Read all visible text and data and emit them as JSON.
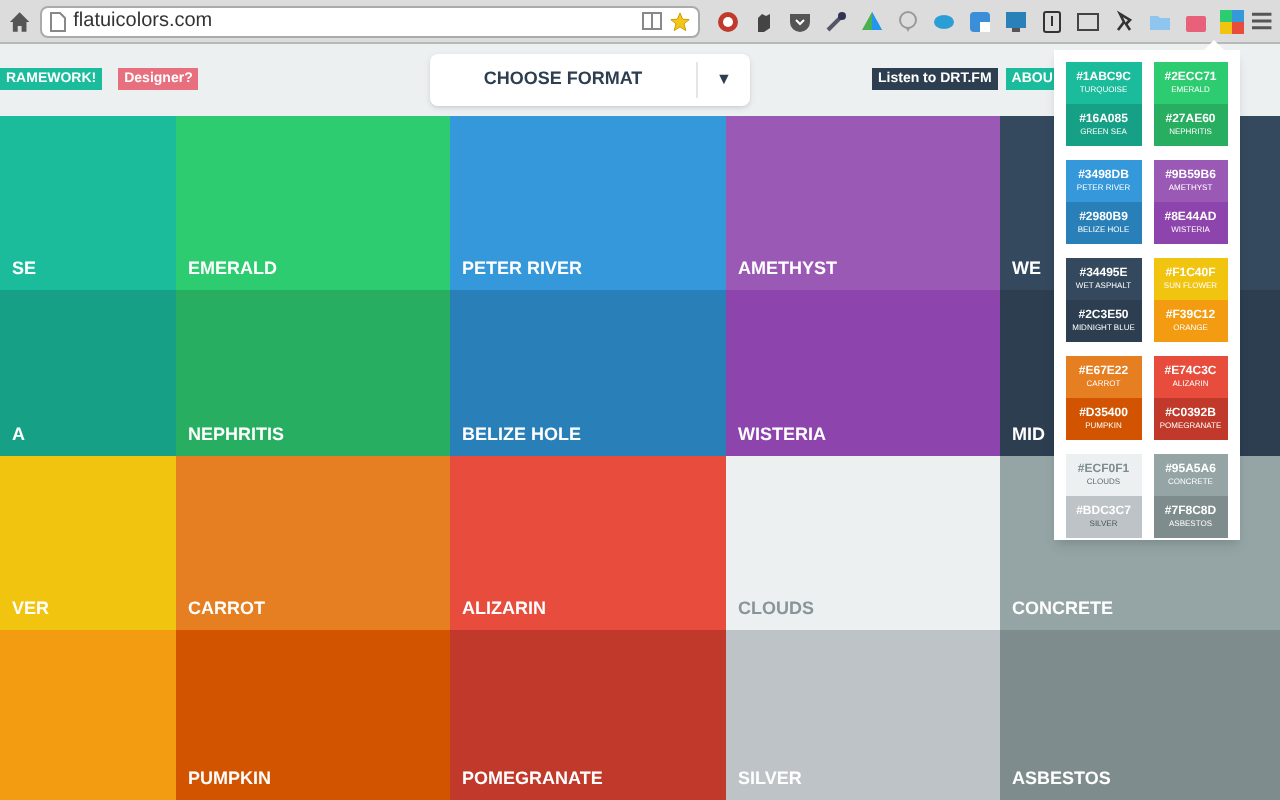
{
  "browser": {
    "url": "flatuicolors.com"
  },
  "header": {
    "badges": [
      {
        "text": "RAMEWORK!",
        "color": "#1abc9c"
      },
      {
        "text": "Designer?",
        "color": "#e8707e"
      }
    ],
    "format_select": {
      "label": "CHOOSE FORMAT",
      "arrow": "▼"
    },
    "right_badges": [
      {
        "text": "Listen to DRT.FM",
        "color": "#2c3e50"
      },
      {
        "text": "ABOU",
        "color": "#1abc9c"
      }
    ]
  },
  "tiles": [
    [
      {
        "label": "SE",
        "color": "#1abc9c"
      },
      {
        "label": "EMERALD",
        "color": "#2ecc71"
      },
      {
        "label": "PETER RIVER",
        "color": "#3498db"
      },
      {
        "label": "AMETHYST",
        "color": "#9b59b6"
      },
      {
        "label": "WE",
        "color": "#34495e"
      }
    ],
    [
      {
        "label": "A",
        "color": "#16a085"
      },
      {
        "label": "NEPHRITIS",
        "color": "#27ae60"
      },
      {
        "label": "BELIZE HOLE",
        "color": "#2980b9"
      },
      {
        "label": "WISTERIA",
        "color": "#8e44ad"
      },
      {
        "label": "MID",
        "color": "#2c3e50"
      }
    ],
    [
      {
        "label": "VER",
        "color": "#f1c40f"
      },
      {
        "label": "CARROT",
        "color": "#e67e22"
      },
      {
        "label": "ALIZARIN",
        "color": "#e74c3c"
      },
      {
        "label": "CLOUDS",
        "color": "#ecf0f1"
      },
      {
        "label": "CONCRETE",
        "color": "#95a5a6"
      }
    ],
    [
      {
        "color": "#f39c12"
      },
      {
        "label": "PUMPKIN",
        "color": "#d35400"
      },
      {
        "label": "POMEGRANATE",
        "color": "#c0392b"
      },
      {
        "label": "SILVER",
        "color": "#bdc3c7"
      },
      {
        "label": "ASBESTOS",
        "color": "#7f8c8d"
      }
    ]
  ],
  "popup": [
    [
      {
        "hex": "#1ABC9C",
        "name": "TURQUOISE",
        "color": "#1abc9c"
      },
      {
        "hex": "#16A085",
        "name": "GREEN SEA",
        "color": "#16a085"
      }
    ],
    [
      {
        "hex": "#2ECC71",
        "name": "EMERALD",
        "color": "#2ecc71"
      },
      {
        "hex": "#27AE60",
        "name": "NEPHRITIS",
        "color": "#27ae60"
      }
    ],
    [
      {
        "hex": "#3498DB",
        "name": "PETER RIVER",
        "color": "#3498db"
      },
      {
        "hex": "#2980B9",
        "name": "BELIZE HOLE",
        "color": "#2980b9"
      }
    ],
    [
      {
        "hex": "#9B59B6",
        "name": "AMETHYST",
        "color": "#9b59b6"
      },
      {
        "hex": "#8E44AD",
        "name": "WISTERIA",
        "color": "#8e44ad"
      }
    ],
    [
      {
        "hex": "#34495E",
        "name": "WET ASPHALT",
        "color": "#34495e"
      },
      {
        "hex": "#2C3E50",
        "name": "MIDNIGHT BLUE",
        "color": "#2c3e50"
      }
    ],
    [
      {
        "hex": "#F1C40F",
        "name": "SUN FLOWER",
        "color": "#f1c40f"
      },
      {
        "hex": "#F39C12",
        "name": "ORANGE",
        "color": "#f39c12"
      }
    ],
    [
      {
        "hex": "#E67E22",
        "name": "CARROT",
        "color": "#e67e22"
      },
      {
        "hex": "#D35400",
        "name": "PUMPKIN",
        "color": "#d35400"
      }
    ],
    [
      {
        "hex": "#E74C3C",
        "name": "ALIZARIN",
        "color": "#e74c3c"
      },
      {
        "hex": "#C0392B",
        "name": "POMEGRANATE",
        "color": "#c0392b"
      }
    ],
    [
      {
        "hex": "#ECF0F1",
        "name": "CLOUDS",
        "color": "#ecf0f1"
      },
      {
        "hex": "#BDC3C7",
        "name": "SILVER",
        "color": "#bdc3c7"
      }
    ],
    [
      {
        "hex": "#95A5A6",
        "name": "CONCRETE",
        "color": "#95a5a6"
      },
      {
        "hex": "#7F8C8D",
        "name": "ASBESTOS",
        "color": "#7f8c8d"
      }
    ]
  ]
}
